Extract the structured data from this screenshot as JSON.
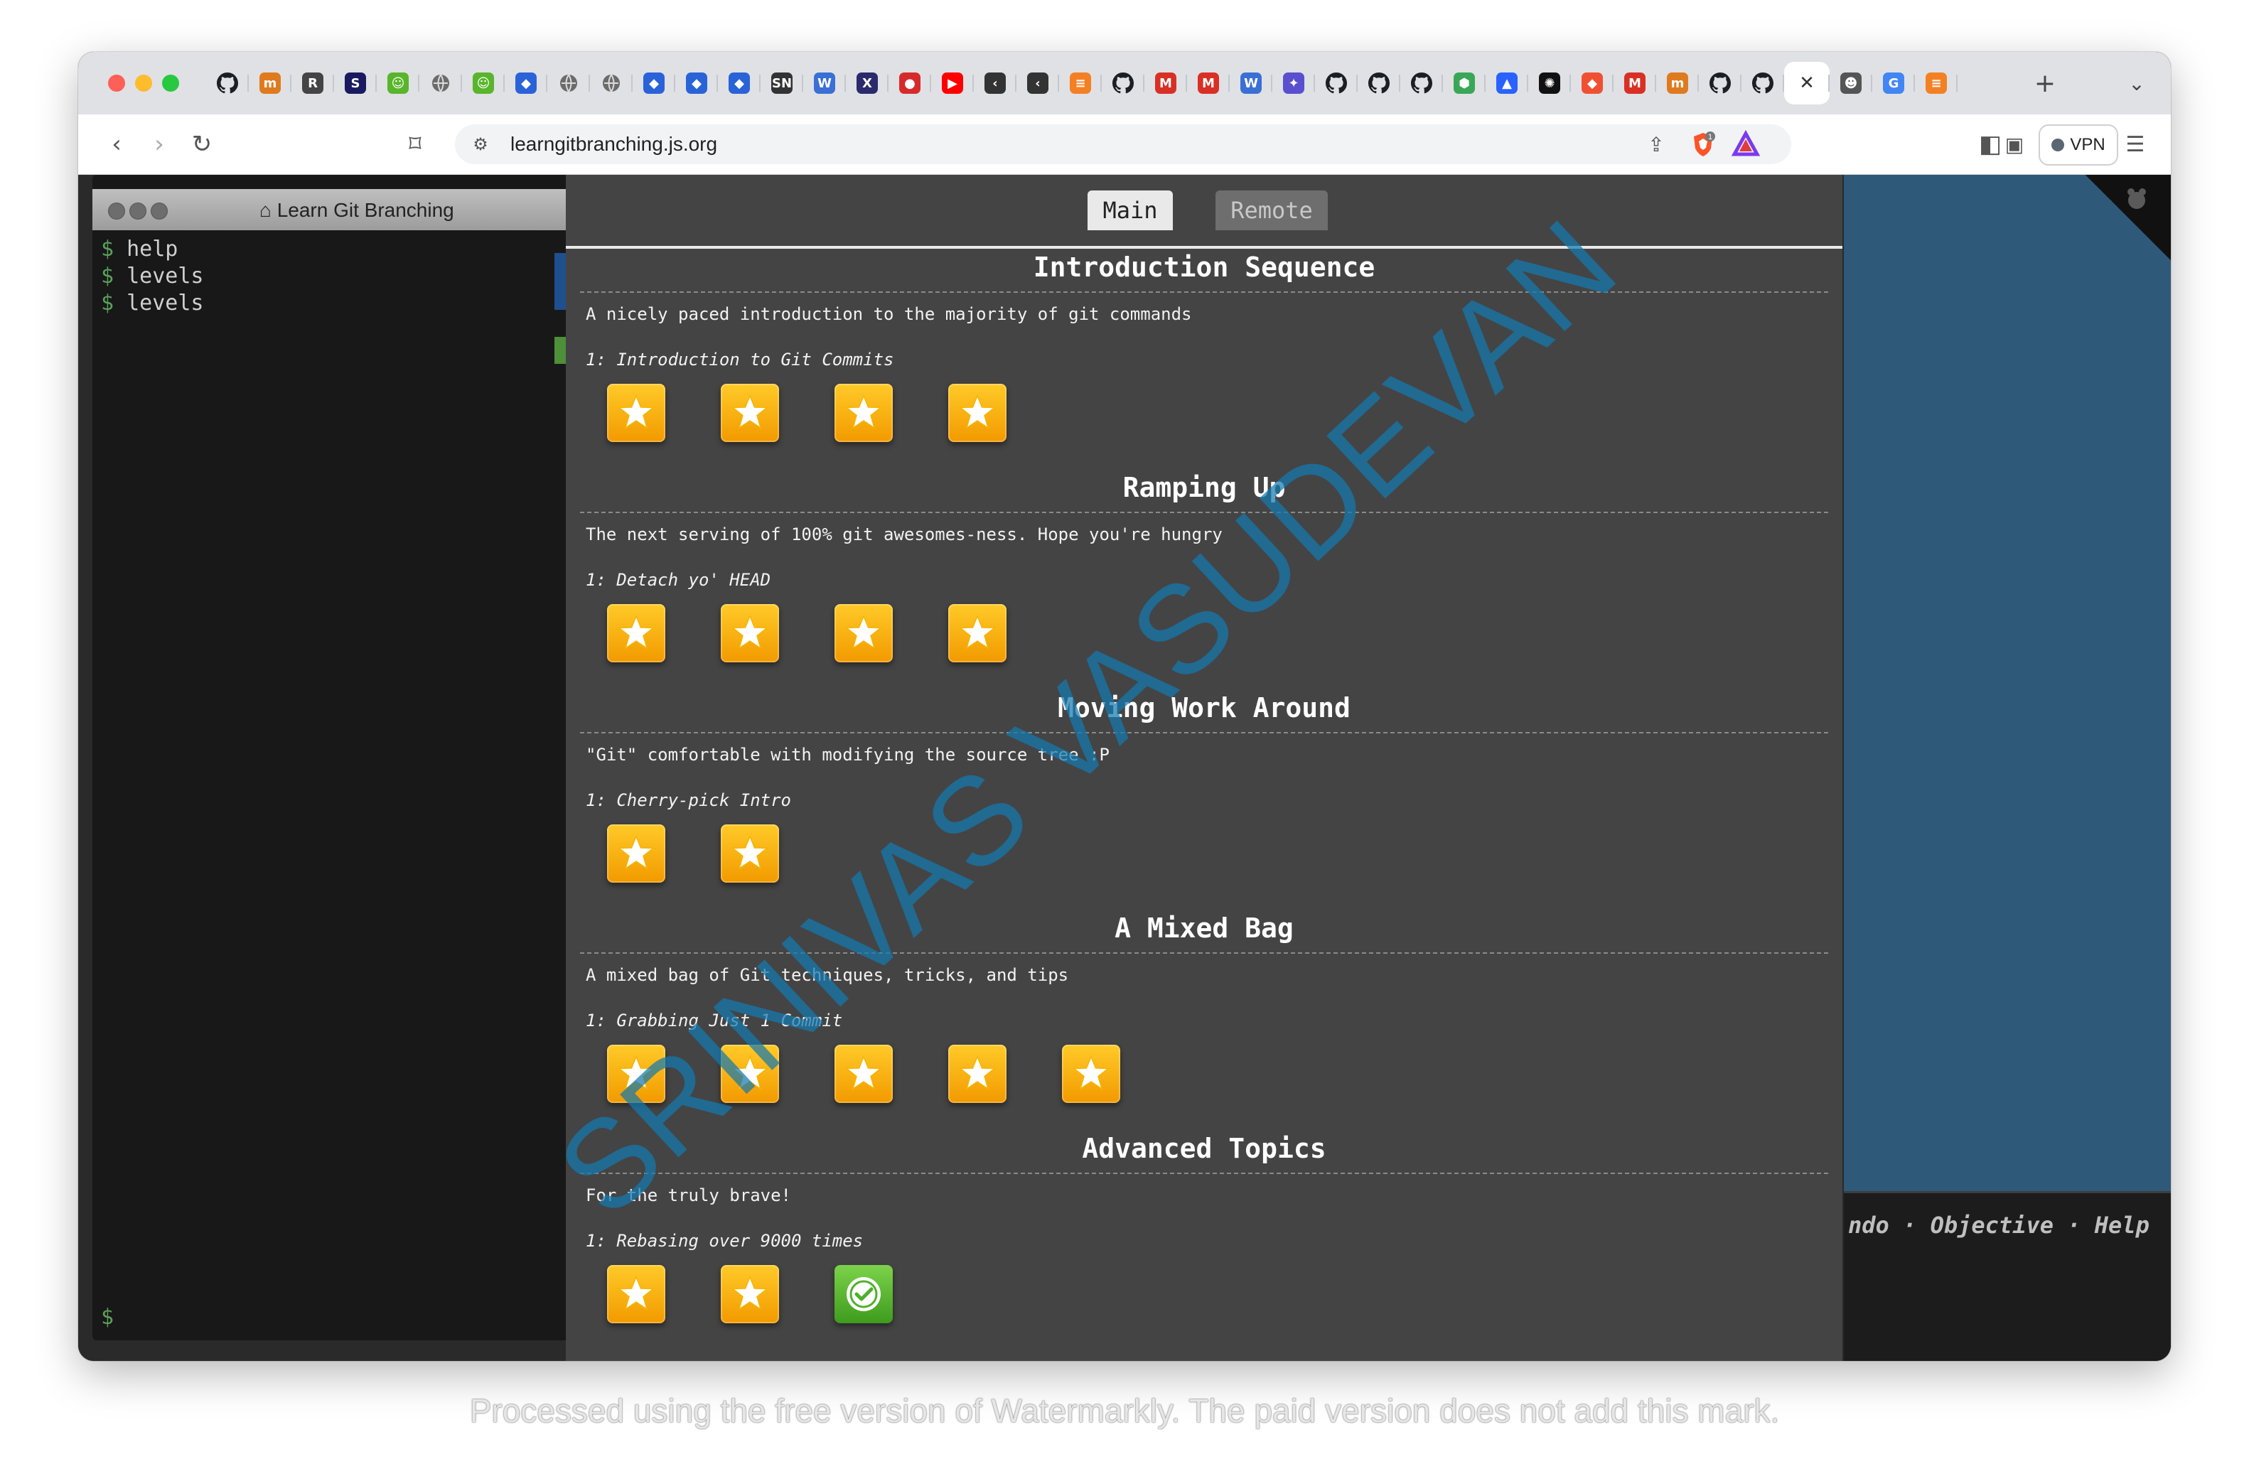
{
  "browser": {
    "tabs": [
      {
        "icon": "github-icon",
        "glyph": "",
        "color": "#1b1f23"
      },
      {
        "icon": "tab-m-icon",
        "glyph": "m",
        "color": "#e07a1f"
      },
      {
        "icon": "tab-r-icon",
        "glyph": "R",
        "color": "#444444"
      },
      {
        "icon": "tab-s-icon",
        "glyph": "S",
        "color": "#1a1a60"
      },
      {
        "icon": "tab-smile-icon",
        "glyph": "☺",
        "color": "#59b52b"
      },
      {
        "icon": "globe-icon",
        "glyph": "",
        "color": "#666666"
      },
      {
        "icon": "tab-smile-icon",
        "glyph": "☺",
        "color": "#59b52b"
      },
      {
        "icon": "tab-diamond-icon",
        "glyph": "◆",
        "color": "#2a63d8"
      },
      {
        "icon": "globe-icon",
        "glyph": "",
        "color": "#666666"
      },
      {
        "icon": "globe-icon",
        "glyph": "",
        "color": "#666666"
      },
      {
        "icon": "tab-diamond-icon",
        "glyph": "◆",
        "color": "#2a63d8"
      },
      {
        "icon": "tab-diamond-icon",
        "glyph": "◆",
        "color": "#2a63d8"
      },
      {
        "icon": "tab-diamond-icon",
        "glyph": "◆",
        "color": "#2a63d8"
      },
      {
        "icon": "tab-sn-icon",
        "glyph": "SN",
        "color": "#333333"
      },
      {
        "icon": "tab-w-icon",
        "glyph": "W",
        "color": "#3b6fd6"
      },
      {
        "icon": "x-logo-icon",
        "glyph": "X",
        "color": "#2b2a6b"
      },
      {
        "icon": "tab-red-badge-icon",
        "glyph": "●",
        "color": "#d62b2b"
      },
      {
        "icon": "youtube-icon",
        "glyph": "▶",
        "color": "#ff0000"
      },
      {
        "icon": "tab-chevron-icon",
        "glyph": "‹",
        "color": "#333333"
      },
      {
        "icon": "tab-chevron-icon",
        "glyph": "‹",
        "color": "#333333"
      },
      {
        "icon": "stackoverflow-icon",
        "glyph": "≡",
        "color": "#f48024"
      },
      {
        "icon": "github-icon",
        "glyph": "",
        "color": "#1b1f23"
      },
      {
        "icon": "gmail-icon",
        "glyph": "M",
        "color": "#d93025"
      },
      {
        "icon": "gmail-icon",
        "glyph": "M",
        "color": "#d93025"
      },
      {
        "icon": "tab-w-icon",
        "glyph": "W",
        "color": "#3b6fd6"
      },
      {
        "icon": "tab-puzzle-icon",
        "glyph": "✦",
        "color": "#5a4fcf"
      },
      {
        "icon": "github-icon",
        "glyph": "",
        "color": "#1b1f23"
      },
      {
        "icon": "github-icon",
        "glyph": "",
        "color": "#1b1f23"
      },
      {
        "icon": "github-icon",
        "glyph": "",
        "color": "#1b1f23"
      },
      {
        "icon": "tab-shield-icon",
        "glyph": "⬢",
        "color": "#3aa757"
      },
      {
        "icon": "tab-triangle-icon",
        "glyph": "▲",
        "color": "#2962ff"
      },
      {
        "icon": "chatgpt-icon",
        "glyph": "✺",
        "color": "#111111"
      },
      {
        "icon": "git-icon",
        "glyph": "◆",
        "color": "#f05032"
      },
      {
        "icon": "gmail-icon",
        "glyph": "M",
        "color": "#d93025"
      },
      {
        "icon": "tab-m-icon",
        "glyph": "m",
        "color": "#e07a1f"
      },
      {
        "icon": "github-icon",
        "glyph": "",
        "color": "#1b1f23"
      },
      {
        "icon": "github-icon",
        "glyph": "",
        "color": "#1b1f23"
      },
      {
        "icon": "close-tab-icon",
        "glyph": "✕",
        "color": "#ffffff",
        "active": true
      },
      {
        "icon": "tab-avatar-icon",
        "glyph": "☻",
        "color": "#555555"
      },
      {
        "icon": "google-icon",
        "glyph": "G",
        "color": "#4285f4"
      },
      {
        "icon": "stackoverflow-icon",
        "glyph": "≡",
        "color": "#f48024"
      }
    ],
    "new_tab_glyph": "+",
    "tab_menu_glyph": "⌄",
    "back_glyph": "‹",
    "forward_glyph": "›",
    "reload_glyph": "↻",
    "bookmark_glyph": "⌑",
    "url": "learngitbranching.js.org",
    "shield_badge": "1",
    "vpn_label": "VPN",
    "sidebar_glyph": "◧",
    "wallet_glyph": "▣",
    "leo_glyph": "✧",
    "menu_glyph": "☰"
  },
  "terminal": {
    "title": "Learn Git Branching",
    "home_glyph": "⌂",
    "prompt": "$",
    "commands": [
      "help",
      "levels",
      "levels"
    ]
  },
  "canvas": {
    "footer_links": "ndo · Objective · Help"
  },
  "dialog": {
    "tabs": {
      "main": "Main",
      "remote": "Remote"
    },
    "sequences": [
      {
        "title": "Introduction Sequence",
        "description": "A nicely paced introduction to the majority of git commands",
        "level_label": "1: Introduction to Git Commits",
        "icons": [
          "star",
          "star",
          "star",
          "star"
        ]
      },
      {
        "title": "Ramping Up",
        "description": "The next serving of 100% git awesomes-ness. Hope you're hungry",
        "level_label": "1: Detach yo' HEAD",
        "icons": [
          "star",
          "star",
          "star",
          "star"
        ]
      },
      {
        "title": "Moving Work Around",
        "description": "\"Git\" comfortable with modifying the source tree :P",
        "level_label": "1: Cherry-pick Intro",
        "icons": [
          "star",
          "star"
        ]
      },
      {
        "title": "A Mixed Bag",
        "description": "A mixed bag of Git techniques, tricks, and tips",
        "level_label": "1: Grabbing Just 1 Commit",
        "icons": [
          "star",
          "star",
          "star",
          "star",
          "star"
        ]
      },
      {
        "title": "Advanced Topics",
        "description": "For the truly brave!",
        "level_label": "1: Rebasing over 9000 times",
        "icons": [
          "star",
          "star",
          "check"
        ]
      }
    ]
  },
  "watermarks": {
    "diagonal": "SRINIVAS VASUDEVAN",
    "footer": "Processed using the free version of Watermarkly. The paid version does not add this mark."
  },
  "colors": {
    "dialog_bg": "#444444",
    "canvas_bg": "#2e5979",
    "star_gold": "#f7b500",
    "check_green": "#4fb02a",
    "prompt_green": "#5ba05b"
  }
}
